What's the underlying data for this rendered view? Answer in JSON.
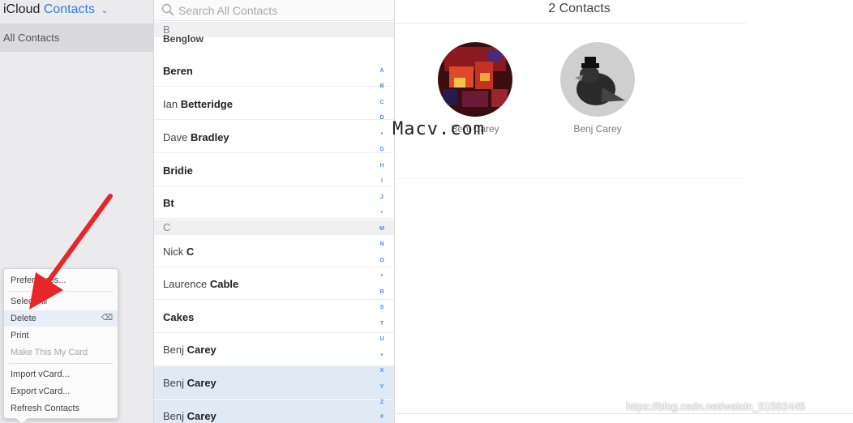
{
  "app": {
    "title_prefix": "iCloud",
    "title_app": "Contacts",
    "chevron": "⌄"
  },
  "sidebar": {
    "group_all": "All Contacts"
  },
  "menu": {
    "items": [
      {
        "label": "Preferences..."
      },
      {
        "label": "Select All"
      },
      {
        "label": "Delete",
        "shortcut": "⌫"
      },
      {
        "label": "Print"
      },
      {
        "label": "Make This My Card"
      },
      {
        "label": "Import vCard..."
      },
      {
        "label": "Export vCard..."
      },
      {
        "label": "Refresh Contacts"
      }
    ]
  },
  "search": {
    "placeholder": "Search All Contacts",
    "icon": "search-icon"
  },
  "list": {
    "partial_row": "Benglow",
    "sections": [
      "B",
      "C"
    ],
    "rows": [
      {
        "first": "",
        "last": "Beren"
      },
      {
        "first": "Ian ",
        "last": "Betteridge"
      },
      {
        "first": "Dave ",
        "last": "Bradley"
      },
      {
        "first": "",
        "last": "Bridie"
      },
      {
        "first": "",
        "last": "Bt"
      },
      {
        "first": "Nick ",
        "last": "C"
      },
      {
        "first": "Laurence ",
        "last": "Cable"
      },
      {
        "first": "",
        "last": "Cakes"
      },
      {
        "first": "Benj ",
        "last": "Carey"
      },
      {
        "first": "Benj ",
        "last": "Carey"
      },
      {
        "first": "Benj ",
        "last": "Carey"
      }
    ],
    "index_letters": [
      "A",
      "B",
      "C",
      "D",
      "•",
      "G",
      "H",
      "I",
      "J",
      "•",
      "M",
      "N",
      "O",
      "•",
      "R",
      "S",
      "T",
      "U",
      "•",
      "X",
      "Y",
      "Z",
      "#"
    ]
  },
  "detail": {
    "title": "2 Contacts",
    "contacts": [
      {
        "name": "Benj Carey"
      },
      {
        "name": "Benj Carey"
      }
    ]
  },
  "watermarks": {
    "top": "Macv.com",
    "bottom": "https://blog.csdn.net/weixin_51582445"
  },
  "colors": {
    "accent": "#3a7bd5",
    "arrow": "#e8262a",
    "selected_row": "#dfeaf4"
  }
}
